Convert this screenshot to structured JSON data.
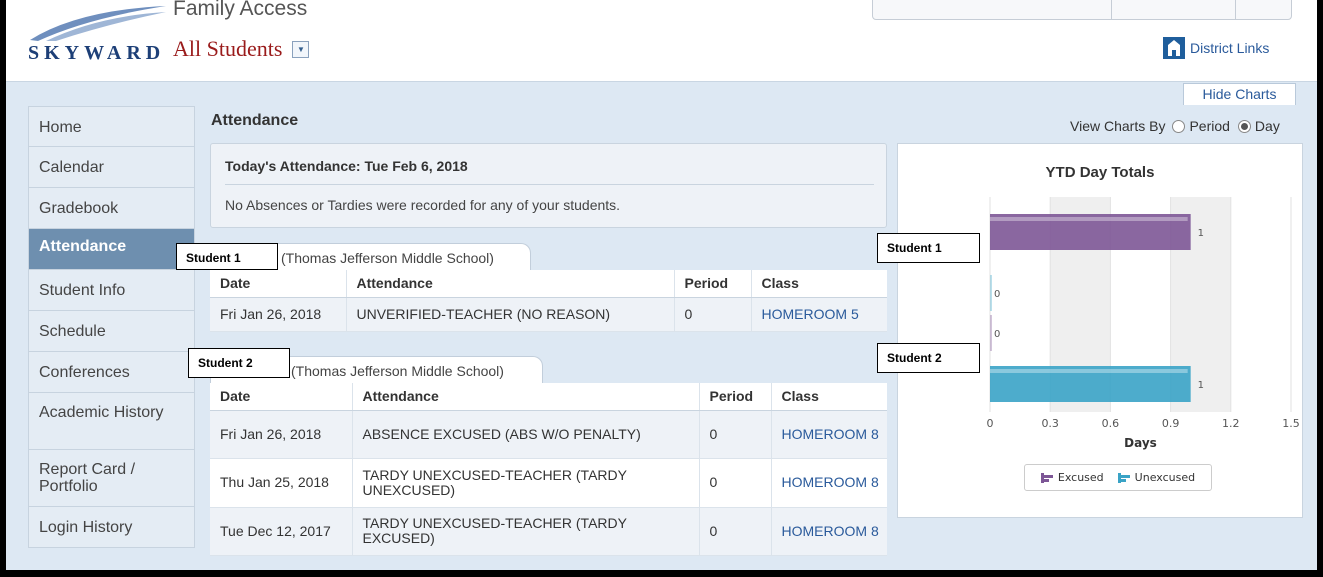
{
  "header": {
    "logo_text": "SKYWARD",
    "app_title": "Family Access",
    "student_selector": "All Students",
    "district_links": "District Links"
  },
  "hide_charts": "Hide Charts",
  "sidebar": {
    "items": [
      {
        "label": "Home"
      },
      {
        "label": "Calendar"
      },
      {
        "label": "Gradebook"
      },
      {
        "label": "Attendance"
      },
      {
        "label": "Student Info"
      },
      {
        "label": "Schedule"
      },
      {
        "label": "Conferences"
      },
      {
        "label": "Academic History"
      },
      {
        "label": "Report Card / Portfolio"
      },
      {
        "label": "Login History"
      }
    ]
  },
  "main": {
    "title": "Attendance",
    "view_charts_by": "View Charts By",
    "option_period": "Period",
    "option_day": "Day",
    "selected_option": "Day",
    "today_title": "Today's Attendance: Tue Feb 6, 2018",
    "today_message": "No Absences or Tardies were recorded for any of your students."
  },
  "students": [
    {
      "label": "Student 1",
      "school": "(Thomas Jefferson Middle School)",
      "columns": [
        "Date",
        "Attendance",
        "Period",
        "Class"
      ],
      "rows": [
        {
          "date": "Fri Jan 26, 2018",
          "attendance": "UNVERIFIED-TEACHER (NO REASON)",
          "period": "0",
          "class": "HOMEROOM 5"
        }
      ]
    },
    {
      "label": "Student 2",
      "school": "(Thomas Jefferson Middle School)",
      "columns": [
        "Date",
        "Attendance",
        "Period",
        "Class"
      ],
      "rows": [
        {
          "date": "Fri Jan 26, 2018",
          "attendance": "ABSENCE EXCUSED (ABS W/O PENALTY)",
          "period": "0",
          "class": "HOMEROOM 8"
        },
        {
          "date": "Thu Jan 25, 2018",
          "attendance": "TARDY UNEXCUSED-TEACHER (TARDY UNEXCUSED)",
          "period": "0",
          "class": "HOMEROOM 8"
        },
        {
          "date": "Tue Dec 12, 2017",
          "attendance": "TARDY UNEXCUSED-TEACHER (TARDY EXCUSED)",
          "period": "0",
          "class": "HOMEROOM 8"
        }
      ]
    }
  ],
  "chart_labels": {
    "student_1": "Student 1",
    "student_2": "Student 2"
  },
  "colors": {
    "excused": "#7d5696",
    "unexcused": "#3aa3c6",
    "active_nav": "#6e8faf",
    "link": "#2a5a9b"
  },
  "chart_data": {
    "type": "bar",
    "orientation": "horizontal",
    "title": "YTD Day Totals",
    "xlabel": "Days",
    "xlim": [
      0,
      1.5
    ],
    "xticks": [
      "0",
      "0.3",
      "0.6",
      "0.9",
      "1.2",
      "1.5"
    ],
    "categories": [
      "Student 1",
      "Student 2"
    ],
    "series": [
      {
        "name": "Excused",
        "values": [
          1,
          0
        ]
      },
      {
        "name": "Unexcused",
        "values": [
          0,
          1
        ]
      }
    ],
    "grid": true,
    "legend": "bottom"
  }
}
